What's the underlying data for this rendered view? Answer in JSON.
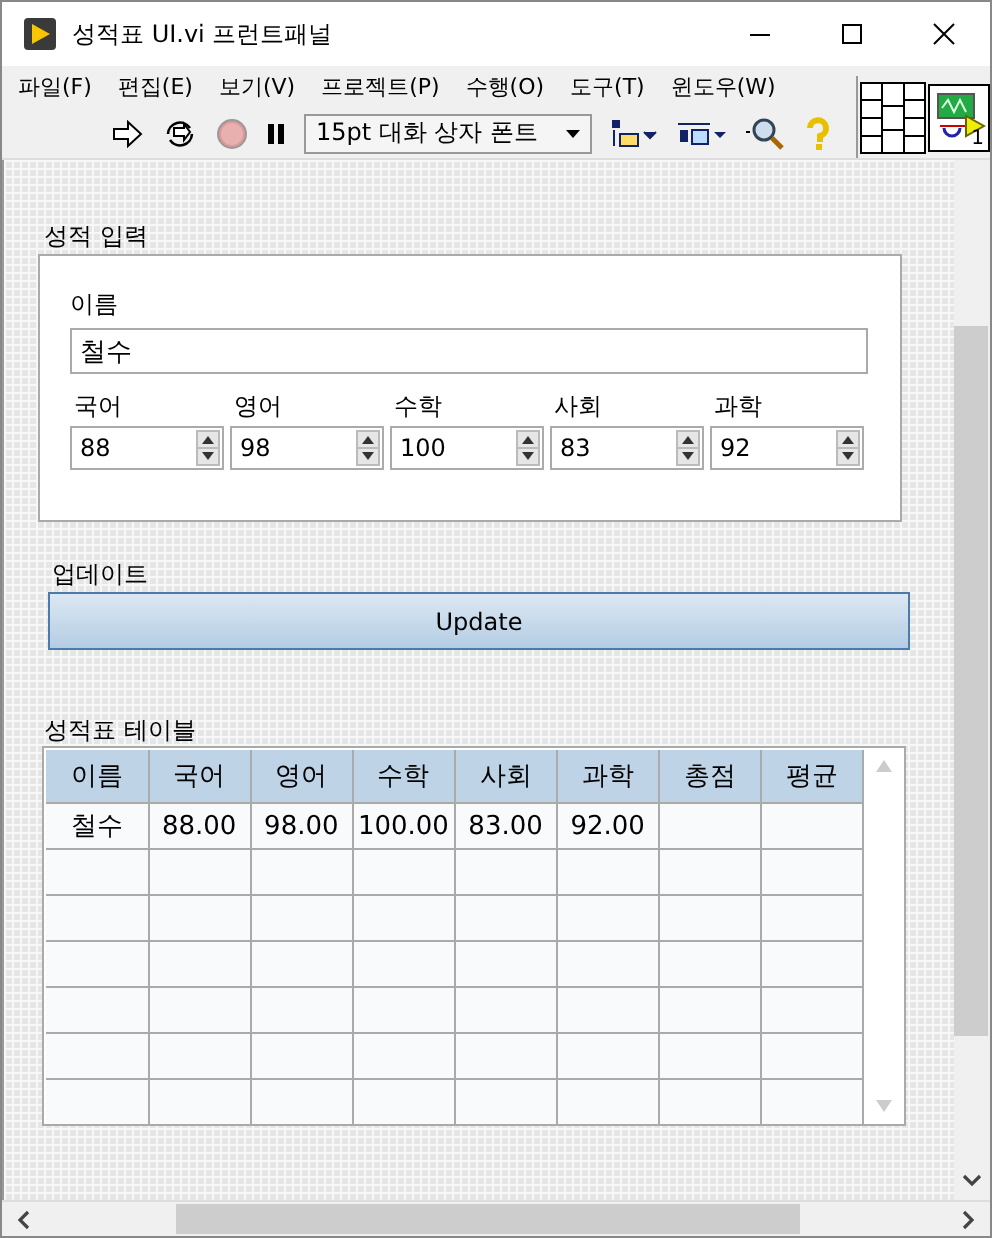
{
  "window": {
    "title": "성적표 UI.vi 프런트패널"
  },
  "menu": [
    "파일(F)",
    "편집(E)",
    "보기(V)",
    "프로젝트(P)",
    "수행(O)",
    "도구(T)",
    "윈도우(W)"
  ],
  "toolbar": {
    "font": "15pt 대화 상자 폰트",
    "connector_number": "1"
  },
  "input_cluster": {
    "label": "성적 입력",
    "name": {
      "label": "이름",
      "value": "철수"
    },
    "scores": [
      {
        "label": "국어",
        "value": "88"
      },
      {
        "label": "영어",
        "value": "98"
      },
      {
        "label": "수학",
        "value": "100"
      },
      {
        "label": "사회",
        "value": "83"
      },
      {
        "label": "과학",
        "value": "92"
      }
    ]
  },
  "update": {
    "label": "업데이트",
    "button": "Update"
  },
  "table": {
    "label": "성적표 테이블",
    "columns": [
      "이름",
      "국어",
      "영어",
      "수학",
      "사회",
      "과학",
      "총점",
      "평균"
    ],
    "rows": [
      [
        "철수",
        "88.00",
        "98.00",
        "100.00",
        "83.00",
        "92.00"
      ]
    ]
  }
}
